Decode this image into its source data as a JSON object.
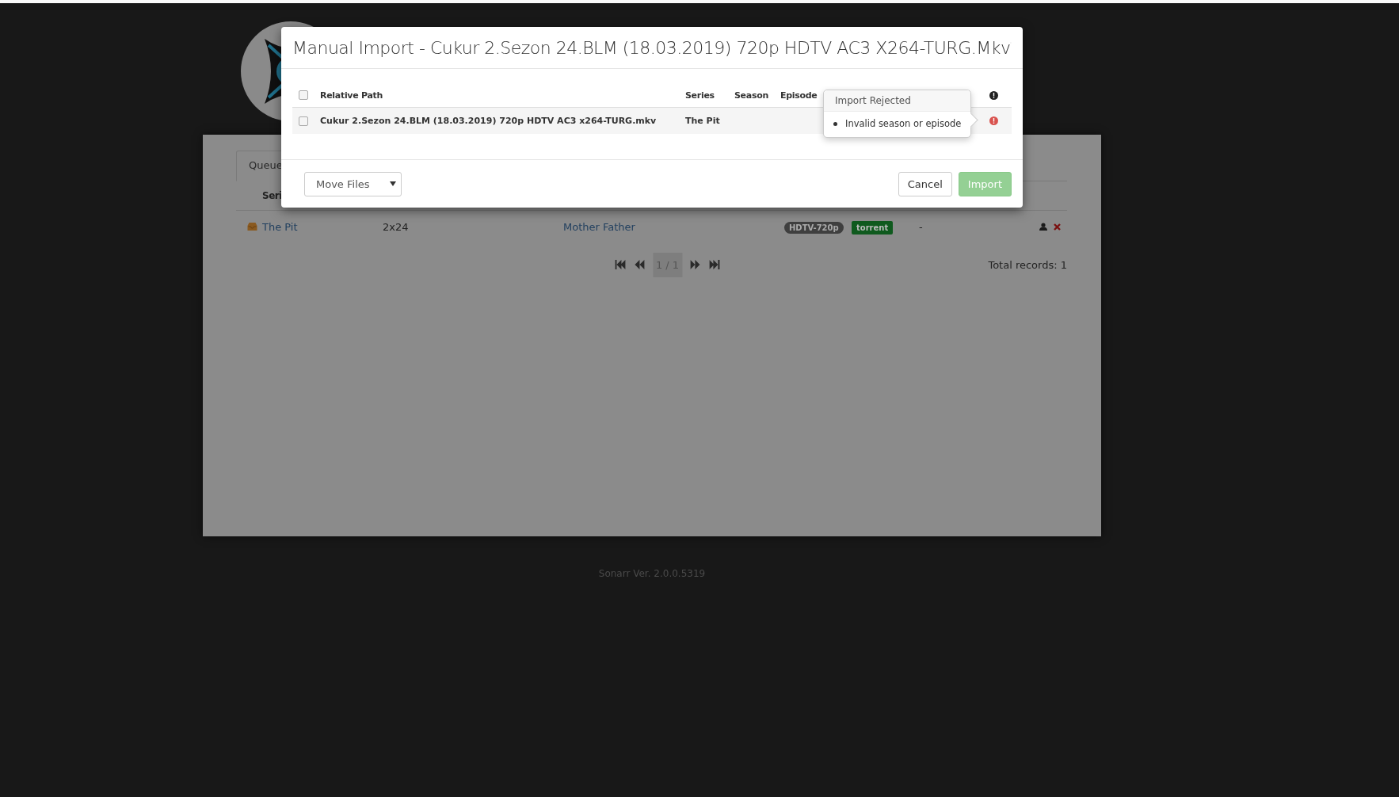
{
  "page": {
    "tabs": [
      {
        "label": "Queue",
        "selected": true
      }
    ],
    "columns": [
      "Seri"
    ],
    "rows": [
      {
        "series": "The Pit",
        "episode": "2x24",
        "episode_title": "Mother Father",
        "quality": "HDTV-720p",
        "protocol": "torrent",
        "column_6": "-"
      }
    ],
    "pager": {
      "label": "1 / 1"
    },
    "total": "Total records: 1",
    "version": "Sonarr Ver. 2.0.0.5319"
  },
  "modal": {
    "title": "Manual Import - Cukur 2.Sezon 24.BLM (18.03.2019) 720p HDTV AC3 X264-TURG.Mkv",
    "select_all": {
      "checked": false
    },
    "columns": [
      "Relative Path",
      "Series",
      "Season",
      "Episode"
    ],
    "rows": [
      {
        "checked": false,
        "relative_path": "Cukur 2.Sezon 24.BLM (18.03.2019) 720p HDTV AC3 x264-TURG.mkv",
        "series": "The Pit",
        "rejected": true
      }
    ],
    "popover": {
      "title": "Import Rejected",
      "items": [
        "Invalid season or episode"
      ]
    },
    "mode": "Move Files",
    "buttons": [
      {
        "label": "Cancel",
        "kind": "default",
        "disabled": false
      },
      {
        "label": "Import",
        "kind": "primary",
        "disabled": true
      }
    ]
  }
}
